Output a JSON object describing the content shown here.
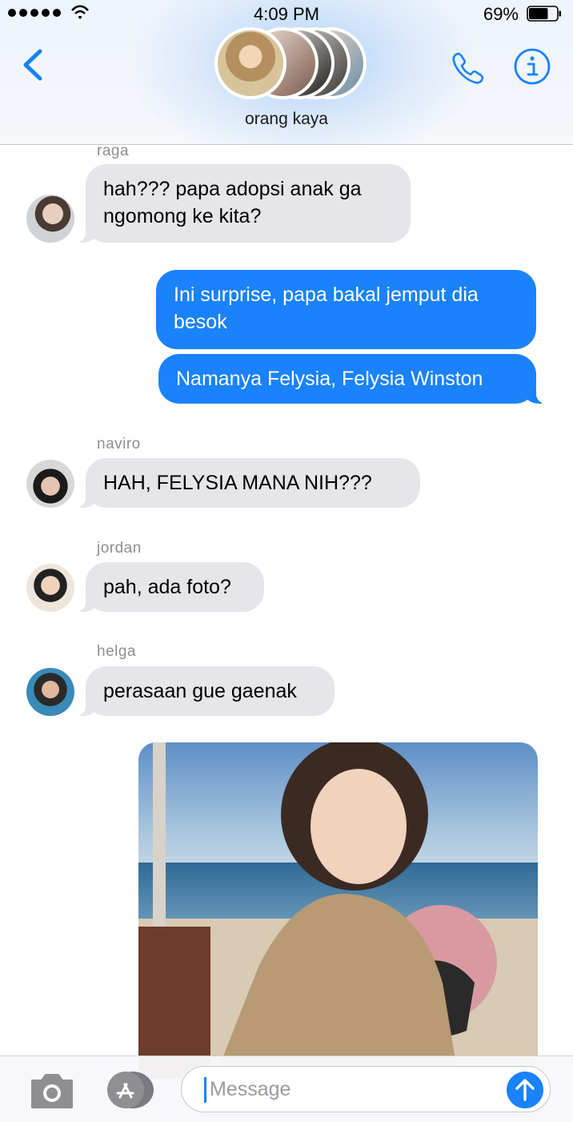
{
  "status_bar": {
    "time": "4:09 PM",
    "battery": "69%",
    "battery_level": 0.69
  },
  "header": {
    "group_name": "orang kaya",
    "icons": [
      "chevron-left-icon",
      "phone-icon",
      "info-icon"
    ]
  },
  "messages": [
    {
      "sender": "raga",
      "direction": "in",
      "text": "hah??? papa adopsi anak ga ngomong ke kita?"
    },
    {
      "direction": "out",
      "text": "Ini surprise, papa bakal jemput dia besok"
    },
    {
      "direction": "out",
      "text": "Namanya Felysia, Felysia Winston"
    },
    {
      "sender": "naviro",
      "direction": "in",
      "text": "HAH, FELYSIA MANA NIH???"
    },
    {
      "sender": "jordan",
      "direction": "in",
      "text": "pah, ada foto?"
    },
    {
      "sender": "helga",
      "direction": "in",
      "text": "perasaan gue gaenak"
    },
    {
      "direction": "out",
      "type": "photo"
    }
  ],
  "input": {
    "placeholder": "Message",
    "icons": [
      "camera-icon",
      "app-store-icon",
      "send-arrow-icon"
    ]
  },
  "colors": {
    "accent": "#1a82fb",
    "incoming_bubble": "#e5e5ea",
    "outgoing_bubble": "#1a82fb",
    "sender_label": "#8e8e93"
  }
}
